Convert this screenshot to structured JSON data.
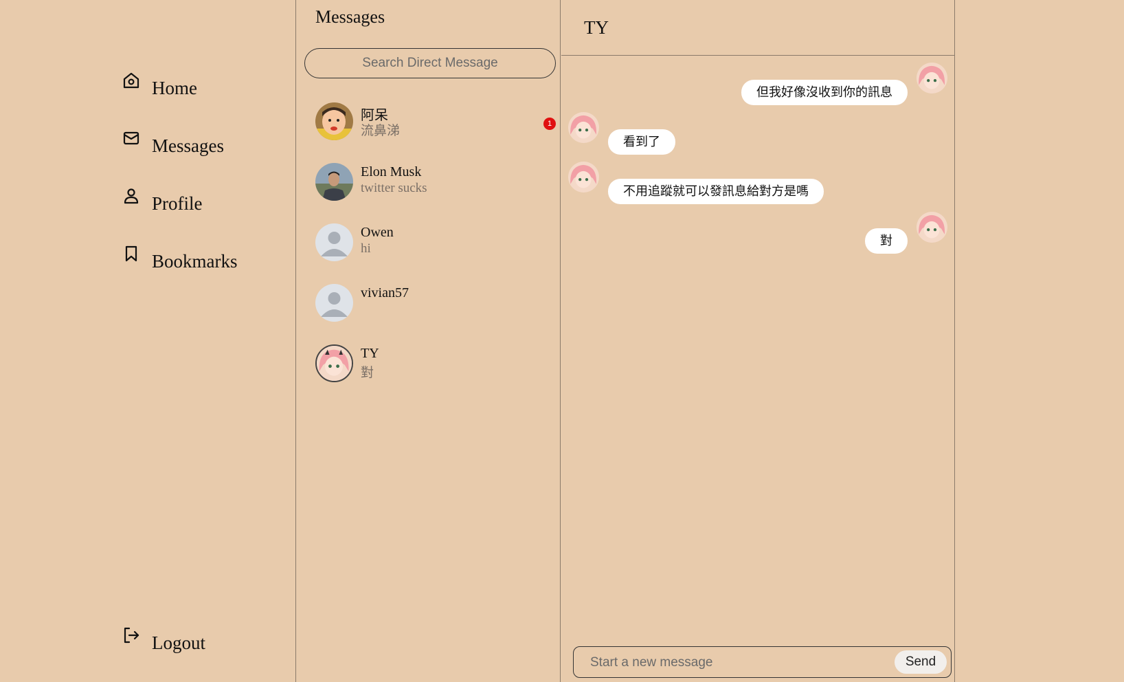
{
  "sidebar": {
    "items": [
      {
        "label": "Home",
        "icon": "home-icon"
      },
      {
        "label": "Messages",
        "icon": "mail-icon"
      },
      {
        "label": "Profile",
        "icon": "user-icon"
      },
      {
        "label": "Bookmarks",
        "icon": "bookmark-icon"
      }
    ],
    "logout": {
      "label": "Logout",
      "icon": "logout-icon"
    }
  },
  "messages_panel": {
    "title": "Messages",
    "search_placeholder": "Search Direct Message",
    "conversations": [
      {
        "name": "阿呆",
        "preview": "流鼻涕",
        "unread": "1",
        "avatar": "cartoon-boy-avatar"
      },
      {
        "name": "Elon Musk",
        "preview": "twitter sucks",
        "avatar": "photo-avatar"
      },
      {
        "name": "Owen",
        "preview": "hi",
        "avatar": "default-avatar"
      },
      {
        "name": "vivian57",
        "preview": "",
        "avatar": "default-avatar"
      },
      {
        "name": "TY",
        "preview": "對",
        "avatar": "anime-girl-avatar"
      }
    ]
  },
  "chat": {
    "title": "TY",
    "messages": [
      {
        "text": "但我好像沒收到你的訊息",
        "side": "right"
      },
      {
        "text": "看到了",
        "side": "left"
      },
      {
        "text": "不用追蹤就可以發訊息給對方是嗎",
        "side": "left"
      },
      {
        "text": "對",
        "side": "right"
      }
    ],
    "input_placeholder": "Start a new message",
    "send_label": "Send"
  },
  "colors": {
    "background": "#e8cbac",
    "bubble": "#ffffff",
    "badge": "#e01010",
    "divider": "#8a7a6a"
  }
}
